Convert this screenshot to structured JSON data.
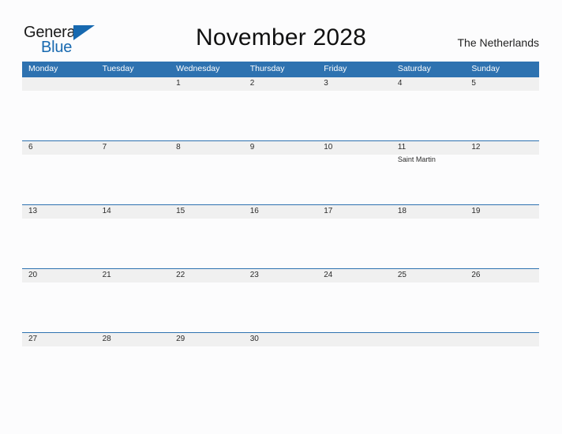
{
  "brand": {
    "name_part1": "General",
    "name_part2": "Blue",
    "accent_color": "#1769b0",
    "triangle_icon": "triangle-right-icon"
  },
  "header": {
    "title": "November 2028",
    "locale": "The Netherlands"
  },
  "theme": {
    "header_blue": "#2e72b0",
    "band_gray": "#f0f0f0",
    "page_background": "#fcfcfd",
    "text_color": "#2b2b2b"
  },
  "calendar": {
    "month": "November",
    "year": "2028",
    "weekday_headers": [
      "Monday",
      "Tuesday",
      "Wednesday",
      "Thursday",
      "Friday",
      "Saturday",
      "Sunday"
    ],
    "weeks": [
      [
        {
          "day": ""
        },
        {
          "day": ""
        },
        {
          "day": "1"
        },
        {
          "day": "2"
        },
        {
          "day": "3"
        },
        {
          "day": "4"
        },
        {
          "day": "5"
        }
      ],
      [
        {
          "day": "6"
        },
        {
          "day": "7"
        },
        {
          "day": "8"
        },
        {
          "day": "9"
        },
        {
          "day": "10"
        },
        {
          "day": "11",
          "event": "Saint Martin"
        },
        {
          "day": "12"
        }
      ],
      [
        {
          "day": "13"
        },
        {
          "day": "14"
        },
        {
          "day": "15"
        },
        {
          "day": "16"
        },
        {
          "day": "17"
        },
        {
          "day": "18"
        },
        {
          "day": "19"
        }
      ],
      [
        {
          "day": "20"
        },
        {
          "day": "21"
        },
        {
          "day": "22"
        },
        {
          "day": "23"
        },
        {
          "day": "24"
        },
        {
          "day": "25"
        },
        {
          "day": "26"
        }
      ],
      [
        {
          "day": "27"
        },
        {
          "day": "28"
        },
        {
          "day": "29"
        },
        {
          "day": "30"
        },
        {
          "day": ""
        },
        {
          "day": ""
        },
        {
          "day": ""
        }
      ]
    ]
  }
}
